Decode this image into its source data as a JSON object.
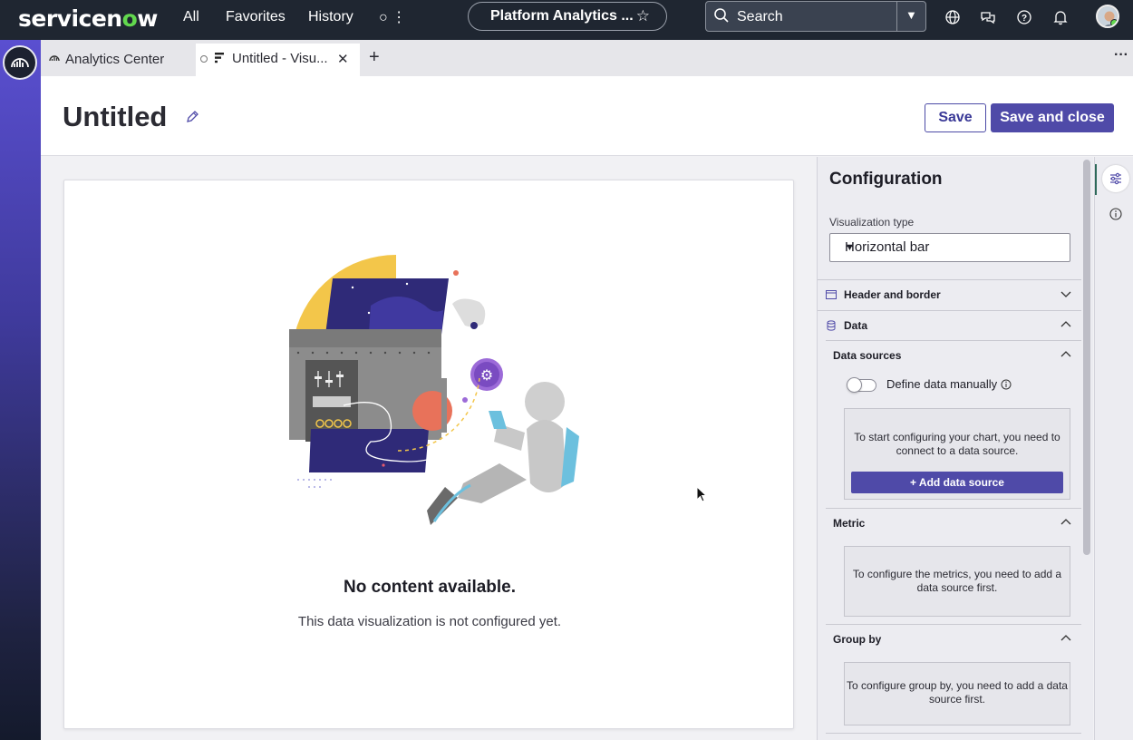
{
  "nav": {
    "brand_prefix": "servicen",
    "brand_o": "o",
    "brand_suffix": "w",
    "links": [
      "All",
      "Favorites",
      "History"
    ],
    "more_label": "○ ⋮",
    "context_pill": "Platform Analytics ...",
    "search_placeholder": "Search"
  },
  "tabs": {
    "tab1_label": "Analytics Center",
    "tab2_label": "Untitled - Visu...",
    "add_label": "+",
    "more_label": "···"
  },
  "header": {
    "title": "Untitled",
    "save_label": "Save",
    "save_close_label": "Save and close"
  },
  "canvas": {
    "empty_title": "No content available.",
    "empty_subtitle": "This data visualization is not configured yet."
  },
  "config": {
    "title": "Configuration",
    "viz_type_label": "Visualization type",
    "viz_type_value": "Horizontal bar",
    "sections": {
      "header_border": "Header and border",
      "data": "Data",
      "data_sources": "Data sources",
      "define_manually": "Define data manually",
      "data_sources_msg": "To start configuring your chart, you need to connect to a data source.",
      "add_data_source": "+ Add data source",
      "metric": "Metric",
      "metric_msg": "To configure the metrics, you need to add a data source first.",
      "group_by": "Group by",
      "group_by_msg": "To configure group by, you need to add a data source first."
    }
  },
  "colors": {
    "topnav": "#1f2631",
    "accent": "#4f4aa8",
    "brand_green": "#62d84e"
  }
}
